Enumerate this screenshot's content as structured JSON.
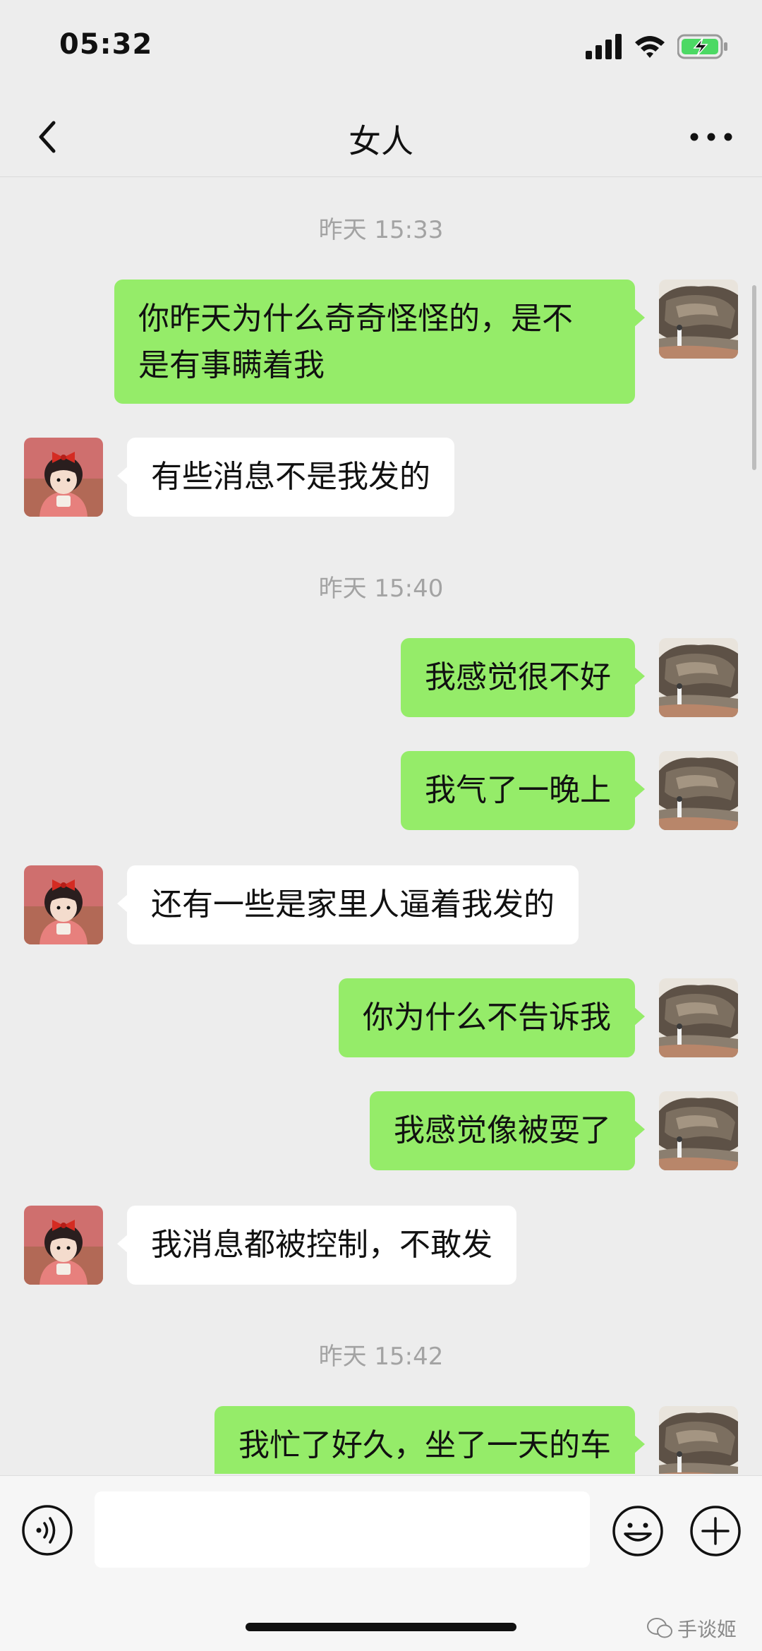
{
  "status_bar": {
    "time": "05:32"
  },
  "nav": {
    "title": "女人"
  },
  "messages": {
    "ts1": "昨天 15:33",
    "m1": [
      "你昨天为什么奇奇怪怪的，是不",
      "是有事瞒着我"
    ],
    "m2": "有些消息不是我发的",
    "ts2": "昨天 15:40",
    "m3": "我感觉很不好",
    "m4": "我气了一晚上",
    "m5": "还有一些是家里人逼着我发的",
    "m6": "你为什么不告诉我",
    "m7": "我感觉像被耍了",
    "m8": "我消息都被控制，不敢发",
    "ts3": "昨天 15:42",
    "m9": "我忙了好久，坐了一天的车"
  },
  "input": {
    "value": "",
    "placeholder": ""
  },
  "watermark": {
    "text": "手谈姬"
  },
  "colors": {
    "outgoing_bubble": "#95ec69",
    "incoming_bubble": "#ffffff",
    "background": "#ededed"
  },
  "icons": {
    "back": "chevron-left-icon",
    "more": "more-dots-icon",
    "voice": "voice-icon",
    "emoji": "smile-icon",
    "plus": "plus-circle-icon",
    "signal": "signal-icon",
    "wifi": "wifi-icon",
    "battery": "battery-charging-icon"
  }
}
